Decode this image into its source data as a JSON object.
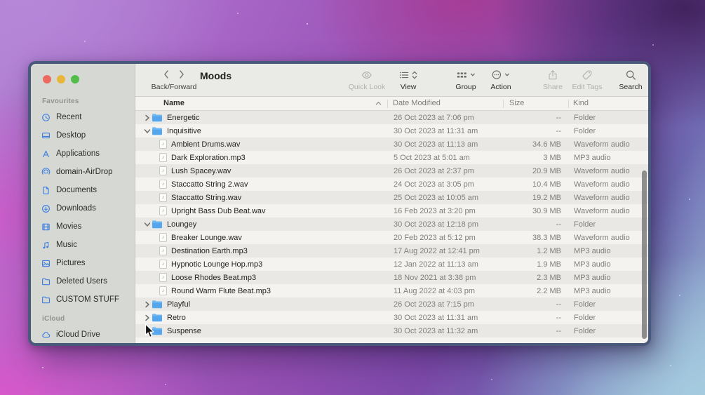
{
  "window": {
    "title": "Moods",
    "nav": {
      "label": "Back/Forward"
    },
    "colors": {
      "border": "#48597b",
      "sidebar_bg": "#d6d9d3",
      "toolbar_bg": "#eaeae7",
      "list_bg": "#f4f3f0",
      "stripe": "#e9e8e5",
      "accent_blue": "#3f7ee2",
      "folder_blue": "#54a7ee",
      "traffic_red": "#ec6a5f",
      "traffic_yellow": "#e9b63c",
      "traffic_green": "#52bd48"
    }
  },
  "toolbar": {
    "tools": [
      {
        "id": "quick-look",
        "label": "Quick Look",
        "icon": "eye-icon",
        "enabled": false
      },
      {
        "id": "view",
        "label": "View",
        "icon": "list-view-icon",
        "enabled": true
      },
      {
        "id": "group",
        "label": "Group",
        "icon": "group-grid-icon",
        "enabled": true
      },
      {
        "id": "action",
        "label": "Action",
        "icon": "ellipsis-circle-icon",
        "enabled": true
      },
      {
        "id": "share",
        "label": "Share",
        "icon": "share-icon",
        "enabled": false
      },
      {
        "id": "edit-tags",
        "label": "Edit Tags",
        "icon": "tag-icon",
        "enabled": false
      },
      {
        "id": "search",
        "label": "Search",
        "icon": "magnifier-icon",
        "enabled": true
      }
    ]
  },
  "sidebar": {
    "sections": [
      {
        "title": "Favourites",
        "items": [
          {
            "label": "Recent",
            "icon": "clock"
          },
          {
            "label": "Desktop",
            "icon": "desktop"
          },
          {
            "label": "Applications",
            "icon": "applications"
          },
          {
            "label": "domain-AirDrop",
            "icon": "airdrop"
          },
          {
            "label": "Documents",
            "icon": "document"
          },
          {
            "label": "Downloads",
            "icon": "download"
          },
          {
            "label": "Movies",
            "icon": "film"
          },
          {
            "label": "Music",
            "icon": "music-note"
          },
          {
            "label": "Pictures",
            "icon": "photo"
          },
          {
            "label": "Deleted Users",
            "icon": "folder"
          },
          {
            "label": "CUSTOM STUFF",
            "icon": "folder"
          }
        ]
      },
      {
        "title": "iCloud",
        "items": [
          {
            "label": "iCloud Drive",
            "icon": "cloud"
          }
        ]
      }
    ]
  },
  "file_list": {
    "columns": [
      "Name",
      "Date Modified",
      "Size",
      "Kind"
    ],
    "sort": {
      "column": "Name",
      "direction": "asc"
    },
    "rows": [
      {
        "name": "Energetic",
        "type": "folder",
        "disclosure": "collapsed",
        "date": "26 Oct 2023 at 7:06 pm",
        "size": "--",
        "kind": "Folder"
      },
      {
        "name": "Inquisitive",
        "type": "folder",
        "disclosure": "expanded",
        "date": "30 Oct 2023 at 11:31 am",
        "size": "--",
        "kind": "Folder"
      },
      {
        "name": "Ambient Drums.wav",
        "type": "file",
        "date": "30 Oct 2023 at 11:13 am",
        "size": "34.6 MB",
        "kind": "Waveform audio"
      },
      {
        "name": "Dark Exploration.mp3",
        "type": "file",
        "date": "5 Oct 2023 at 5:01 am",
        "size": "3 MB",
        "kind": "MP3 audio"
      },
      {
        "name": "Lush Spacey.wav",
        "type": "file",
        "date": "26 Oct 2023 at 2:37 pm",
        "size": "20.9 MB",
        "kind": "Waveform audio"
      },
      {
        "name": "Staccatto String 2.wav",
        "type": "file",
        "date": "24 Oct 2023 at 3:05 pm",
        "size": "10.4 MB",
        "kind": "Waveform audio"
      },
      {
        "name": "Staccatto String.wav",
        "type": "file",
        "date": "25 Oct 2023 at 10:05 am",
        "size": "19.2 MB",
        "kind": "Waveform audio"
      },
      {
        "name": "Upright Bass Dub Beat.wav",
        "type": "file",
        "date": "16 Feb 2023 at 3:20 pm",
        "size": "30.9 MB",
        "kind": "Waveform audio"
      },
      {
        "name": "Loungey",
        "type": "folder",
        "disclosure": "expanded",
        "date": "30 Oct 2023 at 12:18 pm",
        "size": "--",
        "kind": "Folder"
      },
      {
        "name": "Breaker Lounge.wav",
        "type": "file",
        "date": "20 Feb 2023 at 5:12 pm",
        "size": "38.3 MB",
        "kind": "Waveform audio"
      },
      {
        "name": "Destination Earth.mp3",
        "type": "file",
        "date": "17 Aug 2022 at 12:41 pm",
        "size": "1.2 MB",
        "kind": "MP3 audio"
      },
      {
        "name": "Hypnotic Lounge Hop.mp3",
        "type": "file",
        "date": "12 Jan 2022 at 11:13 am",
        "size": "1.9 MB",
        "kind": "MP3 audio"
      },
      {
        "name": "Loose Rhodes Beat.mp3",
        "type": "file",
        "date": "18 Nov 2021 at 3:38 pm",
        "size": "2.3 MB",
        "kind": "MP3 audio"
      },
      {
        "name": "Round Warm Flute Beat.mp3",
        "type": "file",
        "date": "11 Aug 2022 at 4:03 pm",
        "size": "2.2 MB",
        "kind": "MP3 audio"
      },
      {
        "name": "Playful",
        "type": "folder",
        "disclosure": "collapsed",
        "date": "26 Oct 2023 at 7:15 pm",
        "size": "--",
        "kind": "Folder"
      },
      {
        "name": "Retro",
        "type": "folder",
        "disclosure": "collapsed",
        "date": "30 Oct 2023 at 11:31 am",
        "size": "--",
        "kind": "Folder"
      },
      {
        "name": "Suspense",
        "type": "folder",
        "disclosure": "collapsed",
        "date": "30 Oct 2023 at 11:32 am",
        "size": "--",
        "kind": "Folder"
      }
    ]
  }
}
